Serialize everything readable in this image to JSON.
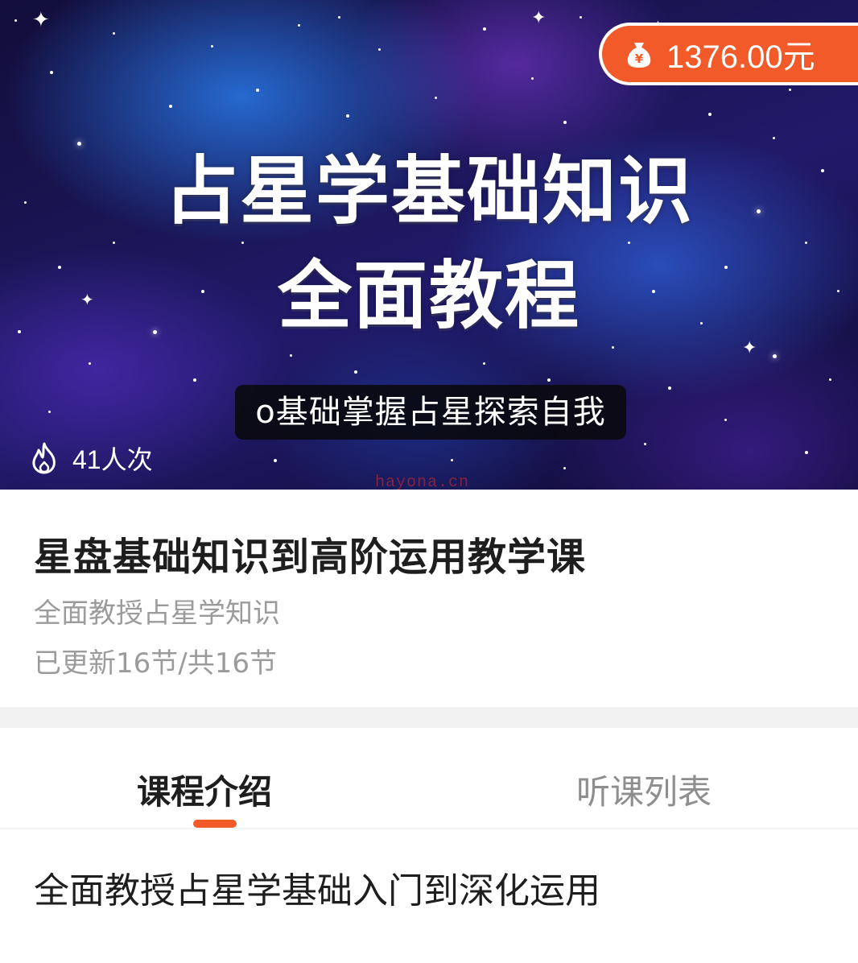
{
  "hero": {
    "title_line1": "占星学基础知识",
    "title_line2": "全面教程",
    "tagline": "o基础掌握占星探索自我",
    "price": "1376.00元",
    "price_icon": "money-bag-icon",
    "views": "41人次",
    "views_icon": "fire-icon",
    "watermark": "hayona.cn"
  },
  "course": {
    "title": "星盘基础知识到高阶运用教学课",
    "subtitle": "全面教授占星学知识",
    "progress": "已更新16节/共16节"
  },
  "tabs": {
    "items": [
      {
        "label": "课程介绍",
        "active": true
      },
      {
        "label": "听课列表",
        "active": false
      }
    ]
  },
  "intro": {
    "text": "全面教授占星学基础入门到深化运用"
  },
  "colors": {
    "accent": "#f25a2a",
    "title_text": "#1e1e1e",
    "muted_text": "#9b9b9b",
    "divider": "#f2f2f2"
  }
}
